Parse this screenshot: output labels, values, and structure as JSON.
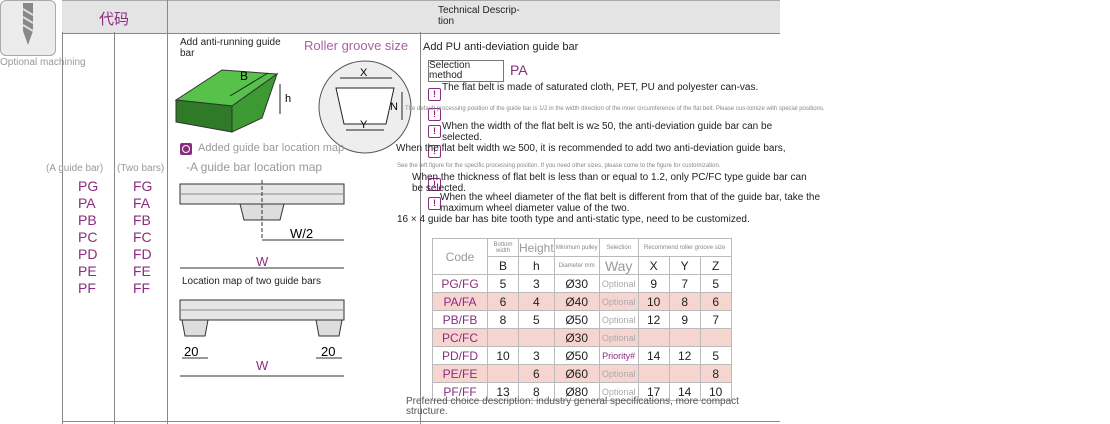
{
  "thumb": {
    "label": "Optional machining"
  },
  "header": {
    "code": "代码",
    "technical": "Technical Descrip-\ntion"
  },
  "codes": {
    "one_bar_label": "(A guide bar)",
    "two_bars_label": "(Two bars)",
    "one_bar": [
      "PG",
      "PA",
      "PB",
      "PC",
      "PD",
      "PE",
      "PF"
    ],
    "two_bars": [
      "FG",
      "FA",
      "FB",
      "FC",
      "FD",
      "FE",
      "FF"
    ]
  },
  "diagrams": {
    "anti_running": "Add anti-running guide bar",
    "roller_groove": "Roller groove size",
    "added_location": "Added guide bar location map",
    "one_location": "-A guide bar location map",
    "two_location": "Location map of two guide bars",
    "dims": {
      "B": "B",
      "h": "h",
      "X": "X",
      "N": "N",
      "Y": "Y",
      "W2": "W/2",
      "W": "W",
      "twenty": "20"
    }
  },
  "desc": {
    "title": "Add PU anti-deviation guide bar",
    "selection": "Selection method",
    "selection_code": "PA",
    "note1": "The flat belt is made of saturated cloth, PET, PU and polyester can-vas.",
    "note2_small": "The default processing position of the guide bar is 1/2 in the width direction of the inner circumference of the flat belt. Please cus-tomize with special positions.",
    "note3": "When the width of the flat belt is w≥ 50, the anti-deviation guide bar can be selected.",
    "note4": "When the flat belt width w≥ 500, it is recommended to add two anti-deviation guide bars,",
    "note4_small": "See the left figure for the specific processing position. If you need other sizes, please come to the figure for customization.",
    "note5": "When the thickness of flat belt is less than or equal to 1.2, only PC/FC type guide bar can be selected.",
    "note6": "When the wheel diameter of the flat belt is different from that of the guide bar, take the maximum wheel diameter value of the two.",
    "note7": "16 × 4 guide bar has bite tooth type and anti-static type, need to be customized.",
    "footer": "Preferred choice description: industry general specifications, more compact structure."
  },
  "table": {
    "head_code": "Code",
    "head_bottom": "Bottom width",
    "head_height": "Height",
    "head_pulley": "Minimum pulley",
    "head_selection": "Selection",
    "head_recommend": "Recommend roller groove size",
    "sub_B": "B",
    "sub_h": "h",
    "sub_dia": "Diameter mm",
    "sub_way": "Way",
    "sub_X": "X",
    "sub_Y": "Y",
    "sub_Z": "Z",
    "rows": [
      {
        "code": "PG/FG",
        "b": "5",
        "h": "3",
        "d": "Ø30",
        "way": "Optional",
        "x": "9",
        "y": "7",
        "z": "5"
      },
      {
        "code": "PA/FA",
        "b": "6",
        "h": "4",
        "d": "Ø40",
        "way": "Optional",
        "x": "10",
        "y": "8",
        "z": "6"
      },
      {
        "code": "PB/FB",
        "b": "8",
        "h": "5",
        "d": "Ø50",
        "way": "Optional",
        "x": "12",
        "y": "9",
        "z": "7"
      },
      {
        "code": "PC/FC",
        "b": "",
        "h": "",
        "d": "Ø30",
        "way": "Optional",
        "x": "",
        "y": "",
        "z": ""
      },
      {
        "code": "PD/FD",
        "b": "10",
        "h": "3",
        "d": "Ø50",
        "way": "Priority#",
        "x": "14",
        "y": "12",
        "z": "5"
      },
      {
        "code": "PE/FE",
        "b": "",
        "h": "6",
        "d": "Ø60",
        "way": "Optional",
        "x": "",
        "y": "",
        "z": "8"
      },
      {
        "code": "PF/FF",
        "b": "13",
        "h": "8",
        "d": "Ø80",
        "way": "Optional",
        "x": "17",
        "y": "14",
        "z": "10"
      }
    ]
  },
  "colors": {
    "accent": "#8a2d7e",
    "green": "#3fa535",
    "pink": "#f6d5d0"
  }
}
